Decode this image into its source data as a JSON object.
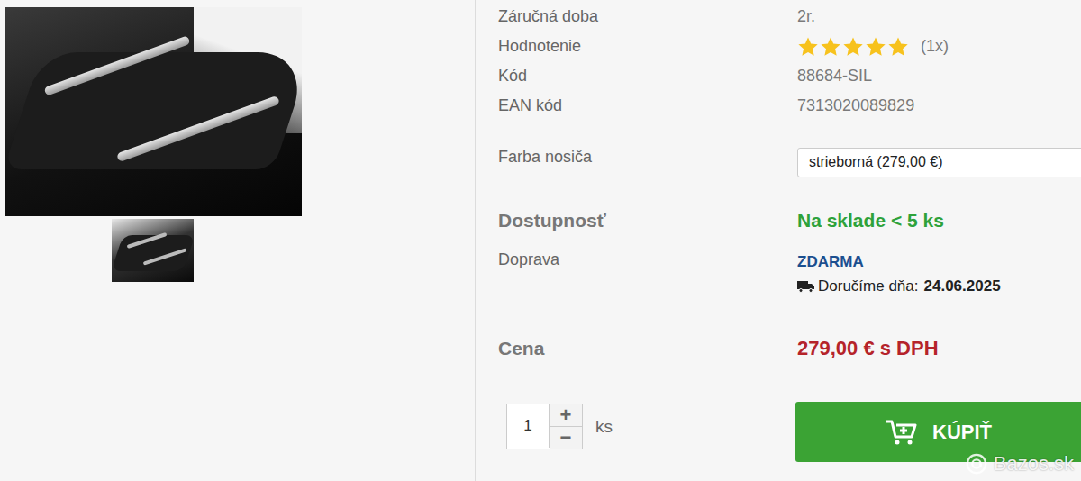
{
  "details": [
    {
      "kind": "text",
      "label": "Záručná doba",
      "value": "2r."
    },
    {
      "kind": "rating",
      "label": "Hodnotenie",
      "stars": 5,
      "value": "(1x)"
    },
    {
      "kind": "text",
      "label": "Kód",
      "value": "88684-SIL"
    },
    {
      "kind": "text",
      "label": "EAN kód",
      "value": "7313020089829"
    }
  ],
  "color_option": {
    "label": "Farba nosiča",
    "value": "strieborná (279,00 €)"
  },
  "availability": {
    "label": "Dostupnosť",
    "value": "Na sklade < 5 ks"
  },
  "shipping": {
    "label": "Doprava",
    "value": "ZDARMA",
    "delivery_label": "Doručíme dňa:",
    "delivery_date": "24.06.2025"
  },
  "price": {
    "label": "Cena",
    "value": "279,00 € s DPH"
  },
  "quantity": {
    "value": "1",
    "increment": "+",
    "decrement": "−",
    "unit": "ks"
  },
  "buy_button": {
    "label": "KÚPIŤ"
  },
  "watermark": {
    "text": "Bazos.sk"
  }
}
